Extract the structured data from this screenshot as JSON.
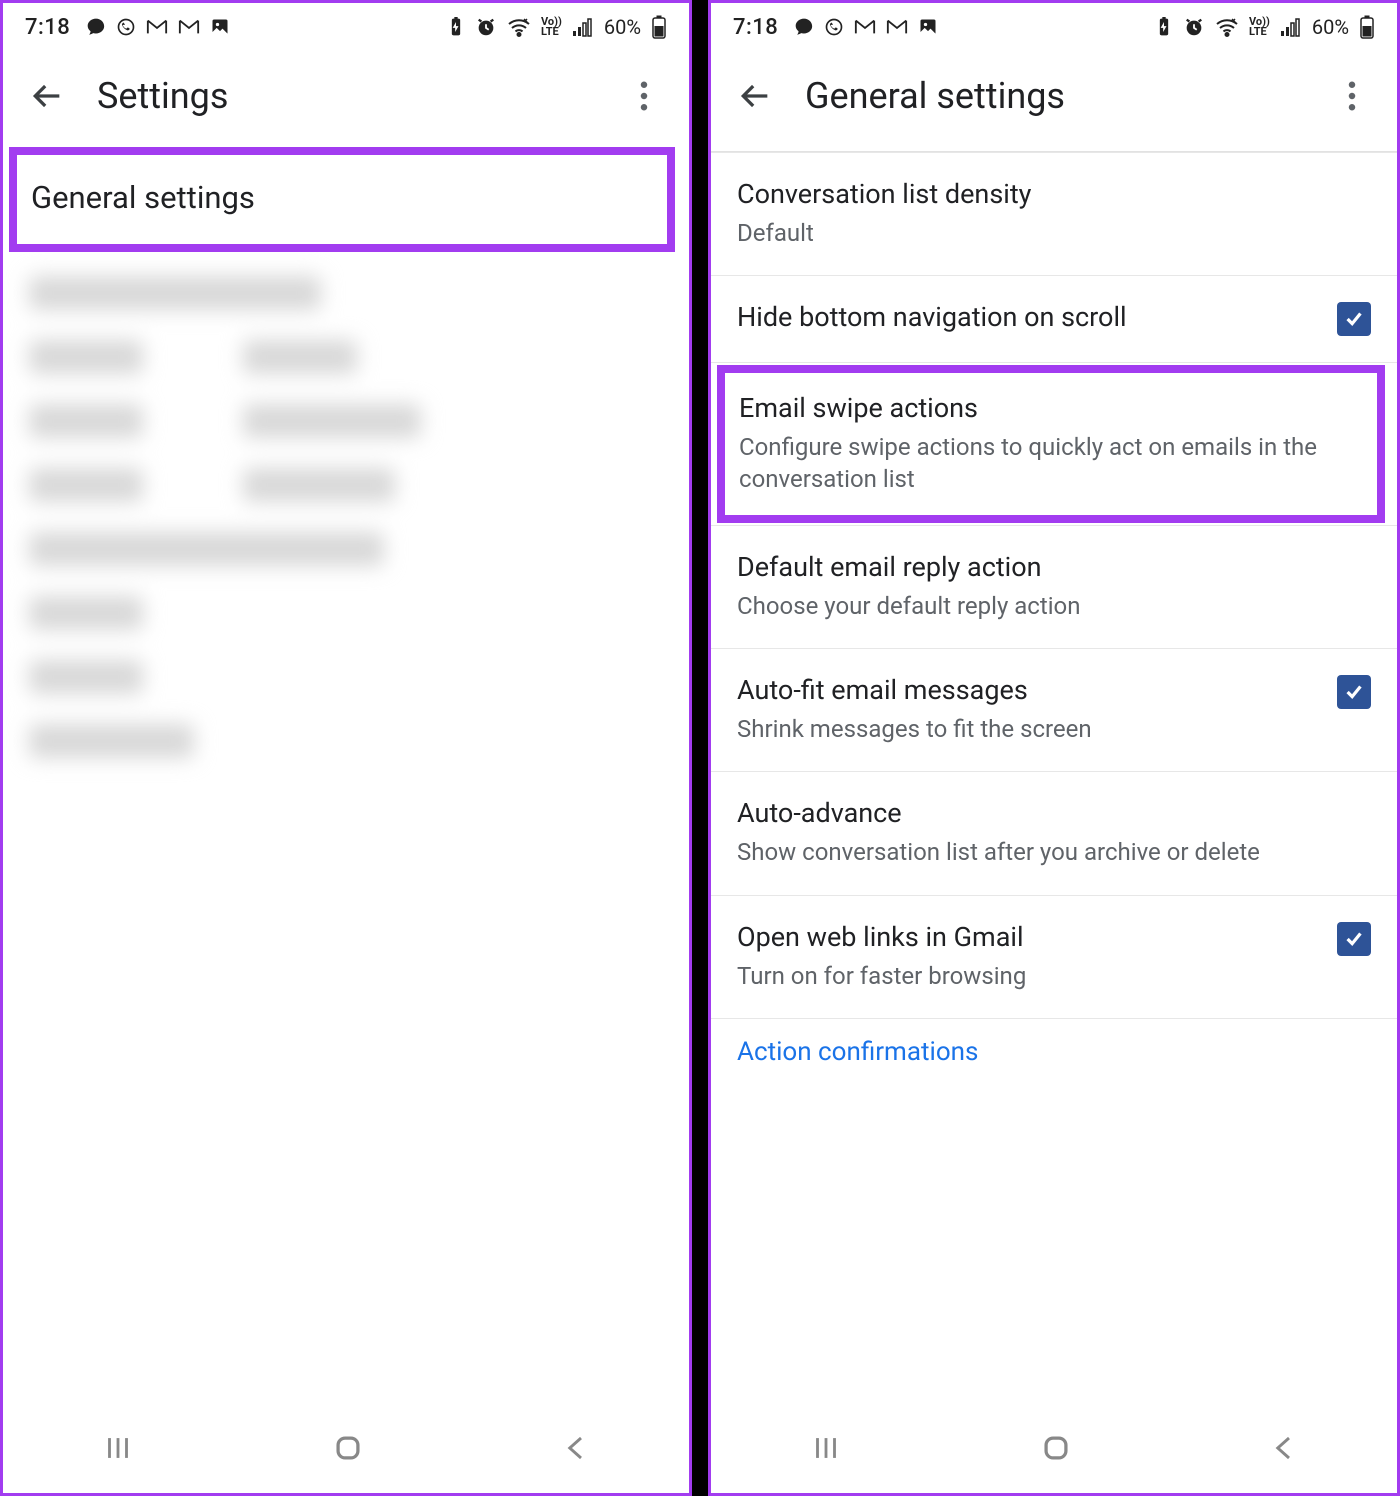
{
  "status": {
    "time": "7:18",
    "battery": "60%"
  },
  "left": {
    "title": "Settings",
    "general_settings": "General settings"
  },
  "right": {
    "title": "General settings",
    "items": {
      "density": {
        "title": "Conversation list density",
        "sub": "Default"
      },
      "hide_nav": {
        "title": "Hide bottom navigation on scroll"
      },
      "swipe": {
        "title": "Email swipe actions",
        "sub": "Configure swipe actions to quickly act on emails in the conversation list"
      },
      "reply": {
        "title": "Default email reply action",
        "sub": "Choose your default reply action"
      },
      "autofit": {
        "title": "Auto-fit email messages",
        "sub": "Shrink messages to fit the screen"
      },
      "advance": {
        "title": "Auto-advance",
        "sub": "Show conversation list after you archive or delete"
      },
      "weblinks": {
        "title": "Open web links in Gmail",
        "sub": "Turn on for faster browsing"
      },
      "action_conf": "Action confirmations"
    }
  }
}
